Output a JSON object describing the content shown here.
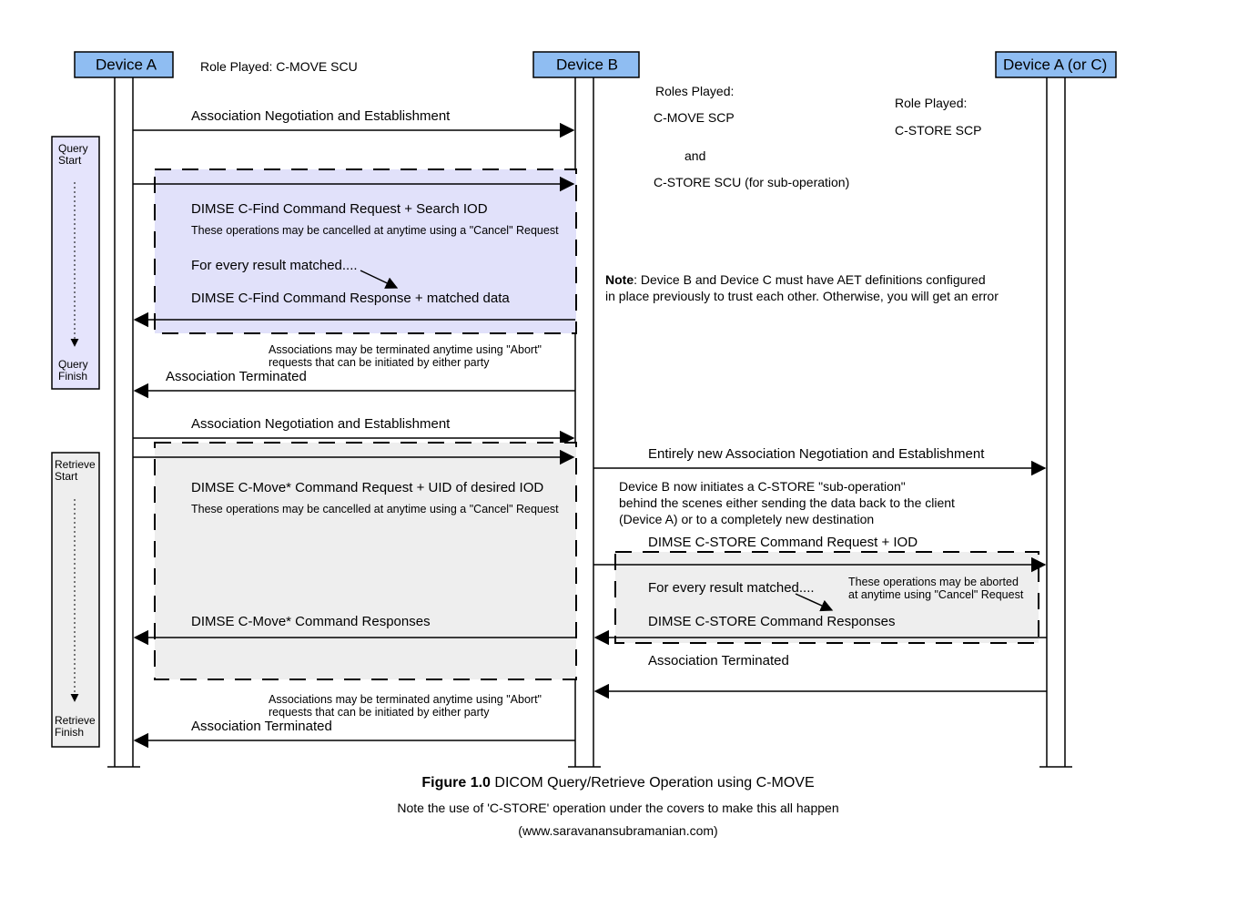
{
  "participants": {
    "deviceA": "Device A",
    "deviceB": "Device B",
    "deviceAC": "Device A (or C)"
  },
  "roles": {
    "left": "Role Played: C-MOVE SCU",
    "centerHeader": "Roles Played:",
    "centerL1": "C-MOVE SCP",
    "centerL2": "and",
    "centerL3": "C-STORE SCU (for sub-operation)",
    "rightHeader": "Role Played:",
    "rightL1": "C-STORE SCP"
  },
  "phases": {
    "queryStart": "Query\nStart",
    "queryFinish": "Query\nFinish",
    "retrieveStart": "Retrieve\nStart",
    "retrieveFinish": "Retrieve\nFinish"
  },
  "messages": {
    "assocEst": "Association Negotiation and Establishment",
    "cfindReq": "DIMSE C-Find Command Request + Search IOD",
    "cancelNote": "These operations may be cancelled at anytime using a \"Cancel\" Request",
    "forEvery": "For every result matched....",
    "cfindResp": "DIMSE C-Find Command Response + matched data",
    "abortNote": "Associations may be terminated anytime using \"Abort\"\nrequests that can be initiated by either party",
    "assocTerm": "Association Terminated",
    "assocEst2": "Association Negotiation and Establishment",
    "cmoveReq": "DIMSE C-Move* Command Request + UID of desired IOD",
    "cmoveResp": "DIMSE C-Move* Command Responses",
    "newAssoc": "Entirely new Association Negotiation and Establishment",
    "subOp": "Device B now initiates a C-STORE \"sub-operation\"\nbehind the scenes either sending the data back to the client\n(Device A) or to a completely new destination",
    "cstoreReq": "DIMSE C-STORE Command Request + IOD",
    "cstoreResp": "DIMSE C-STORE Command Responses",
    "cancelNote2": "These operations may be aborted\nat anytime using \"Cancel\" Request"
  },
  "sideNote": {
    "prefix": "Note",
    "body": ": Device B and Device C must have AET definitions configured\nin place previously to trust each other. Otherwise, you will get an error"
  },
  "caption": {
    "titlePrefix": "Figure 1.0",
    "title": " DICOM Query/Retrieve Operation using C-MOVE",
    "sub1": "Note the use of 'C-STORE' operation under the covers to make this all happen",
    "sub2": "(www.saravanansubramanian.com)"
  },
  "colors": {
    "participant": "#8fbdf2",
    "queryBlock": "#e1e1fa",
    "retrieveBlock": "#eeeeee",
    "phaseQuery": "#e5e4fc",
    "phaseRetrieve": "#eeeeee"
  }
}
